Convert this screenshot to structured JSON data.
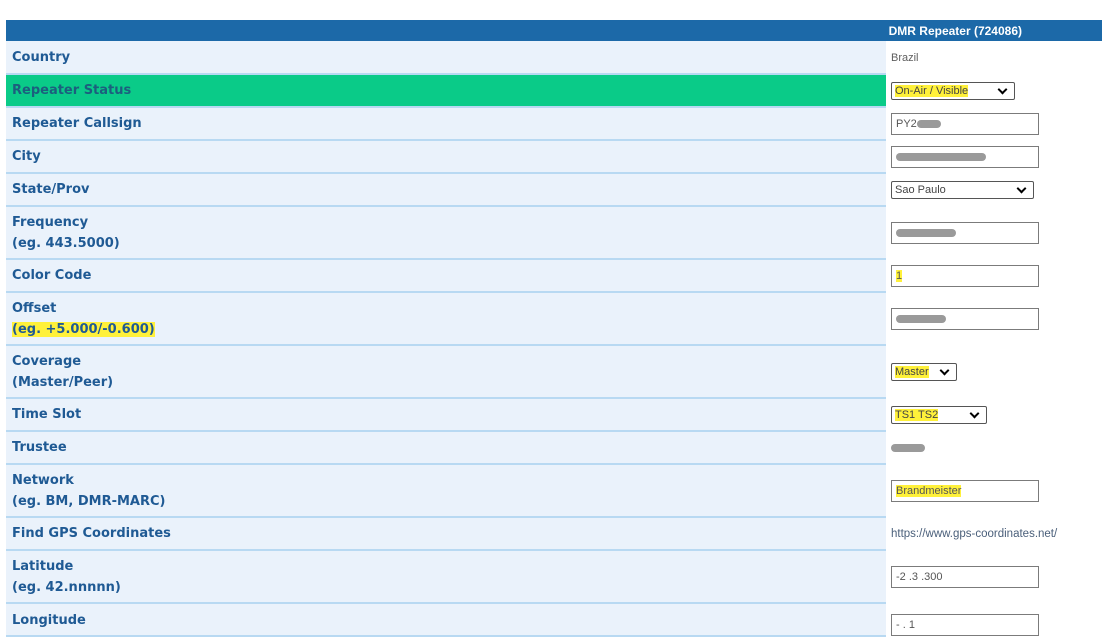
{
  "header": {
    "title": "DMR Repeater (724086)"
  },
  "fields": {
    "country": {
      "label": "Country",
      "value": "Brazil"
    },
    "status": {
      "label": "Repeater Status",
      "selected": "On-Air / Visible"
    },
    "callsign": {
      "label": "Repeater Callsign",
      "value": "PY2"
    },
    "city": {
      "label": "City"
    },
    "state": {
      "label": "State/Prov",
      "selected": "Sao Paulo"
    },
    "frequency": {
      "label": "Frequency",
      "hint": "(eg. 443.5000)"
    },
    "color_code": {
      "label": "Color Code",
      "value": "1"
    },
    "offset": {
      "label": "Offset",
      "hint": "(eg. +5.000/-0.600)"
    },
    "coverage": {
      "label": "Coverage",
      "hint": "(Master/Peer)",
      "selected": "Master"
    },
    "time_slot": {
      "label": "Time Slot",
      "selected": "TS1 TS2"
    },
    "trustee": {
      "label": "Trustee"
    },
    "network": {
      "label": "Network",
      "hint": "(eg. BM, DMR-MARC)",
      "value": "Brandmeister"
    },
    "gps": {
      "label": "Find GPS Coordinates",
      "link": "https://www.gps-coordinates.net/"
    },
    "latitude": {
      "label": "Latitude",
      "hint": "(eg. 42.nnnnn)",
      "value": "-2 .3 .300"
    },
    "longitude": {
      "label": "Longitude",
      "value": "-  . 1"
    }
  },
  "colors": {
    "header_bg": "#1c69a8",
    "row_bg": "#eaf2fb",
    "status_row_bg": "#0acb88",
    "label_text": "#1f5a94",
    "highlight": "#fff13a"
  }
}
